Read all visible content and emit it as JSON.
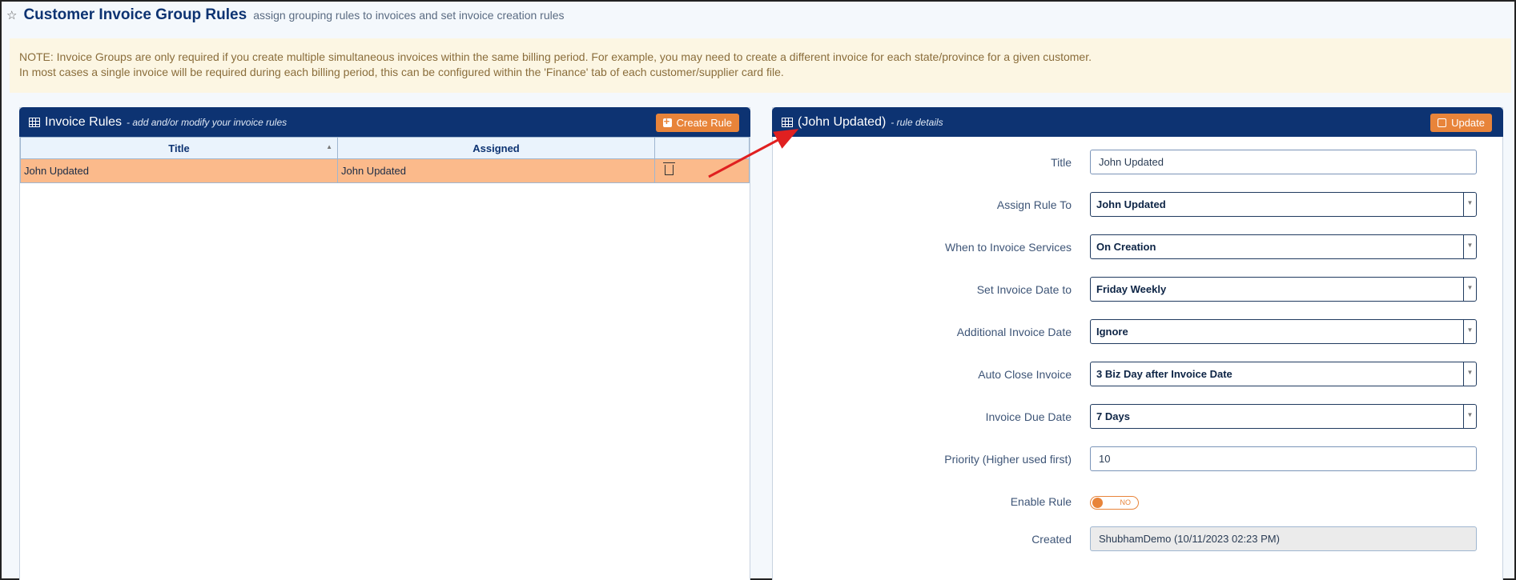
{
  "header": {
    "star_icon": "star-outline-icon",
    "title": "Customer Invoice Group Rules",
    "subtitle": "assign grouping rules to invoices and set invoice creation rules"
  },
  "note": {
    "line1": "NOTE: Invoice Groups are only required if you create multiple simultaneous invoices within the same billing period. For example, you may need to create a different invoice for each state/province for a given customer.",
    "line2": "In most cases a single invoice will be required during each billing period, this can be configured within the 'Finance' tab of each customer/supplier card file."
  },
  "left_panel": {
    "title": "Invoice Rules",
    "subtitle": "- add and/or modify your invoice rules",
    "create_button": "Create Rule",
    "columns": [
      "Title",
      "Assigned",
      ""
    ],
    "rows": [
      {
        "title": "John Updated",
        "assigned": "John Updated"
      }
    ]
  },
  "right_panel": {
    "title": "(John Updated)",
    "subtitle": "- rule details",
    "update_button": "Update",
    "fields": {
      "title": {
        "label": "Title",
        "value": "John Updated"
      },
      "assign_rule_to": {
        "label": "Assign Rule To",
        "value": "John Updated"
      },
      "when_to_invoice": {
        "label": "When to Invoice Services",
        "value": "On Creation"
      },
      "set_invoice_date": {
        "label": "Set Invoice Date to",
        "value": "Friday Weekly"
      },
      "additional_date": {
        "label": "Additional Invoice Date",
        "value": "Ignore"
      },
      "auto_close": {
        "label": "Auto Close Invoice",
        "value": "3 Biz Day after Invoice Date"
      },
      "due_date": {
        "label": "Invoice Due Date",
        "value": "7 Days"
      },
      "priority": {
        "label": "Priority (Higher used first)",
        "value": "10"
      },
      "enable_rule": {
        "label": "Enable Rule",
        "value": "NO"
      },
      "created": {
        "label": "Created",
        "value": "ShubhamDemo (10/11/2023 02:23 PM)"
      }
    }
  },
  "colors": {
    "header_bg": "#0d3372",
    "accent_orange": "#e8843a",
    "selected_row": "#fbba8b",
    "note_bg": "#fcf6e3",
    "annotation_arrow": "#e02020"
  }
}
